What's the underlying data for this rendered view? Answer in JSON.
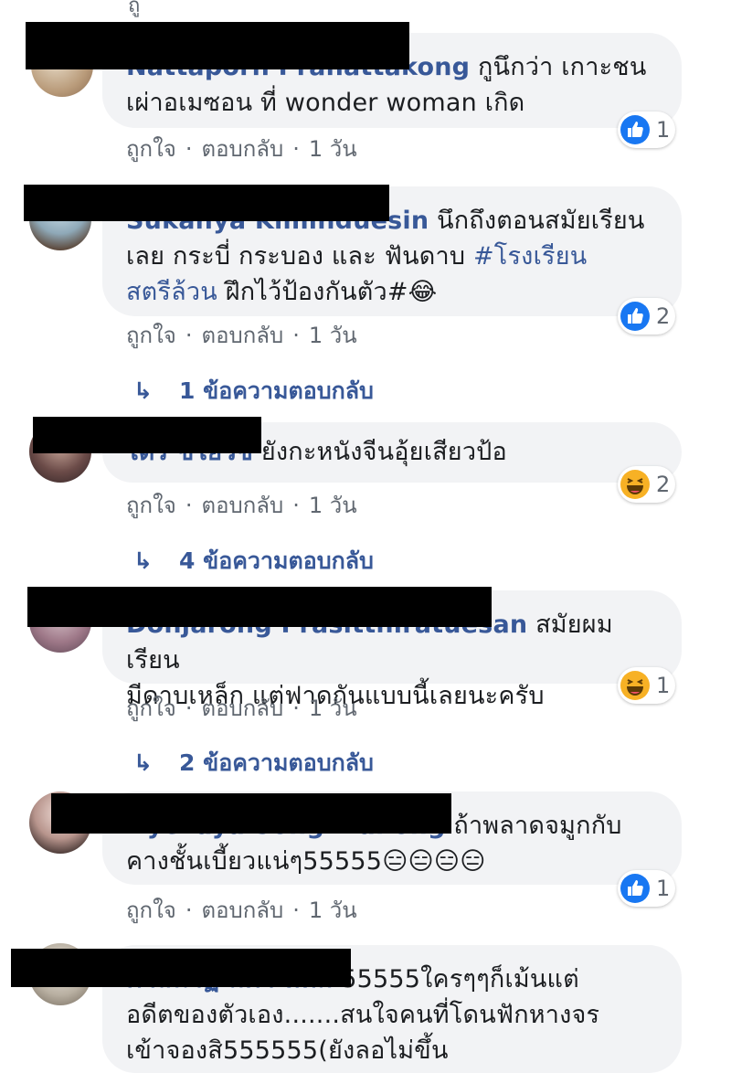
{
  "top_fragment": "ถู",
  "actions": {
    "like": "ถูกใจ",
    "reply": "ตอบกลับ",
    "sep": "·",
    "time": "1 วัน"
  },
  "comments": [
    {
      "name": "Nattaporn Pranattakong",
      "line1_tail": "กูนึกว่า เกาะชน",
      "line2": "เผ่าอเมซอน ที่ wonder woman เกิด",
      "reaction": {
        "type": "like",
        "count": "1"
      }
    },
    {
      "name": "Sukanya Kiminduesin",
      "line1_tail": "นึกถึงตอนสมัยเรียน",
      "line2_plain": "เลย กระบี่ กระบอง และ ฟันดาบ ",
      "line2_tag": "#โรงเรียน",
      "line3_tag": "สตรีล้วน",
      "line3_plain": " ฝึกไว้ป้องกันตัว#",
      "line3_emoji": "😂",
      "reaction": {
        "type": "like",
        "count": "2"
      },
      "replies": "1 ข้อความตอบกลับ"
    },
    {
      "name": "ไดร ขโยวิช",
      "line1_tail": "ยังกะหนังจีนอุ้ยเสียวป้อ",
      "reaction": {
        "type": "haha",
        "count": "2"
      },
      "replies": "4 ข้อความตอบกลับ"
    },
    {
      "name": "Donjarong Prasitthiratuesan",
      "line1_tail": "สมัยผมเรียน",
      "line2": "มีดาบเหล็ก แต่ฟาดกันแบบนี้เลยนะครับ",
      "reaction": {
        "type": "haha",
        "count": "1"
      },
      "replies": "2 ข้อความตอบกลับ"
    },
    {
      "name": "Nychaya Songkhailong",
      "line1_tail": "ถ้าพลาดจมูกกับ",
      "line2": "คางชั้นเบี้ยวแน่ๆ55555",
      "line2_emoji": "😑😑😑😑",
      "reaction": {
        "type": "like",
        "count": "1"
      }
    },
    {
      "name": "ตาลนาฏ มีตา ห้ทิม",
      "line1_tail": "55555ใครๆๆก็เม้นแต่",
      "line2": "อดีตของตัวเอง.......สนใจคนที่โดนฟักหางจร",
      "line3": "เข้าจองสิ555555(ยังลอไม่ขึ้น"
    }
  ],
  "colors": {
    "link": "#385898",
    "meta": "#606770",
    "bubble": "#f2f3f5",
    "like": "#1877f2",
    "haha": "#f7b125"
  }
}
